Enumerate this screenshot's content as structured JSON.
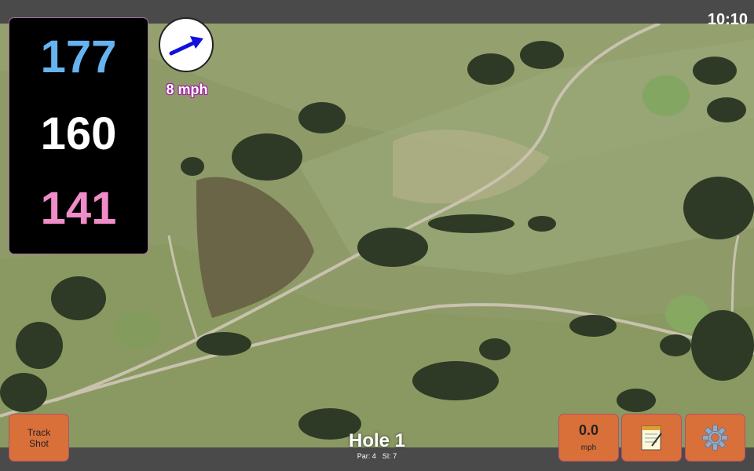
{
  "status": {
    "time": "10:10"
  },
  "distances": {
    "back": "177",
    "middle": "160",
    "front": "141"
  },
  "wind": {
    "speed": "8 mph",
    "icon": "wind-arrow-icon"
  },
  "buttons": {
    "track_line1": "Track",
    "track_line2": "Shot",
    "speed_value": "0.0",
    "speed_unit": "mph",
    "notes_icon": "notepad-icon",
    "settings_icon": "gear-icon"
  },
  "hole": {
    "title": "Hole 1",
    "par": "Par: 4",
    "si": "SI: 7"
  },
  "colors": {
    "back": "#66b3f0",
    "middle": "#ffffff",
    "front": "#f08cc8",
    "button": "#d9703a"
  }
}
